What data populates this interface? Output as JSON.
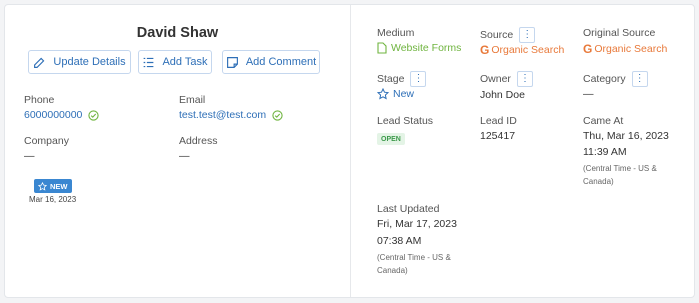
{
  "contact": {
    "name": "David Shaw",
    "buttons": {
      "update": "Update Details",
      "task": "Add Task",
      "comment": "Add Comment"
    },
    "phone_label": "Phone",
    "phone_value": "6000000000",
    "email_label": "Email",
    "email_value": "test.test@test.com",
    "company_label": "Company",
    "company_value": "—",
    "address_label": "Address",
    "address_value": "—",
    "badge": "NEW",
    "badge_date": "Mar 16, 2023"
  },
  "lead": {
    "medium_label": "Medium",
    "medium_value": "Website Forms",
    "source_label": "Source",
    "source_value": "Organic Search",
    "orig_source_label": "Original Source",
    "orig_source_value": "Organic Search",
    "stage_label": "Stage",
    "stage_value": "New",
    "owner_label": "Owner",
    "owner_value": "John Doe",
    "category_label": "Category",
    "category_value": "—",
    "status_label": "Lead Status",
    "status_value": "OPEN",
    "id_label": "Lead ID",
    "id_value": "125417",
    "came_label": "Came At",
    "came_date": "Thu, Mar 16, 2023",
    "came_time": "11:39 AM",
    "came_tz": "(Central Time - US & Canada)",
    "updated_label": "Last Updated",
    "updated_date": "Fri, Mar 17, 2023",
    "updated_time": "07:38 AM",
    "updated_tz": "(Central Time - US & Canada)",
    "menu_glyph": "⋮"
  },
  "colors": {
    "link": "#2e6fb7",
    "green": "#6fb43f",
    "orange": "#e8793a",
    "badge_blue": "#3a87d1"
  }
}
